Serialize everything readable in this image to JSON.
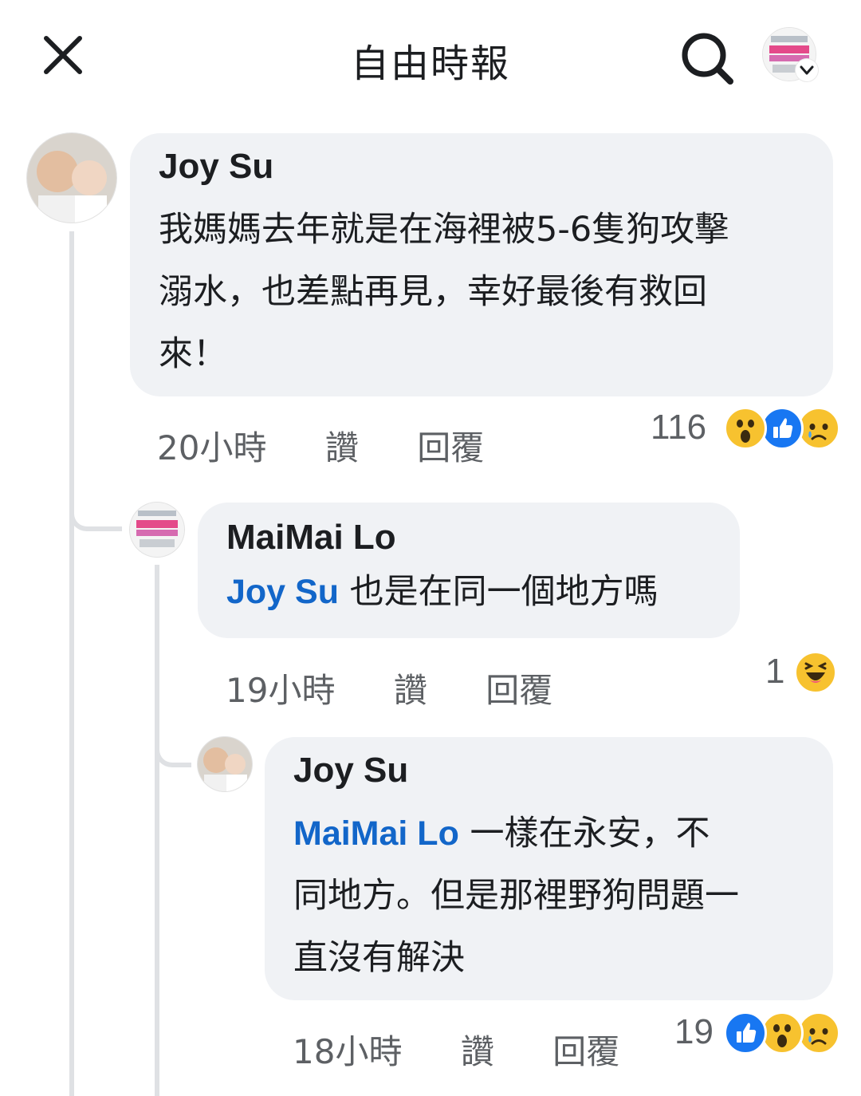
{
  "header": {
    "title": "自由時報",
    "close_icon": "close-icon",
    "search_icon": "search-icon",
    "profile_icon": "profile-avatar",
    "dropdown_icon": "chevron-down-icon"
  },
  "comments": [
    {
      "author": "Joy Su",
      "mention": "",
      "text": "我媽媽去年就是在海裡被5-6隻狗攻擊溺水，也差點再見，幸好最後有救回來！",
      "lines": [
        "我媽媽去年就是在海裡被5-6隻狗攻擊",
        "溺水，也差點再見，幸好最後有救回",
        "來！"
      ],
      "time": "20小時",
      "like_label": "讚",
      "reply_label": "回覆",
      "reaction_count": "116",
      "reactions": [
        "wow-reaction-icon",
        "like-reaction-icon",
        "sad-reaction-icon"
      ]
    },
    {
      "author": "MaiMai Lo",
      "mention": "Joy Su",
      "text": "也是在同一個地方嗎",
      "time": "19小時",
      "like_label": "讚",
      "reply_label": "回覆",
      "reaction_count": "1",
      "reactions": [
        "haha-reaction-icon"
      ]
    },
    {
      "author": "Joy Su",
      "mention": "MaiMai Lo",
      "text": "一樣在永安，不同地方。但是那裡野狗問題一直沒有解決",
      "lines": [
        "一樣在永安，不",
        "同地方。但是那裡野狗問題一",
        "直沒有解決"
      ],
      "time": "18小時",
      "like_label": "讚",
      "reply_label": "回覆",
      "reaction_count": "19",
      "reactions": [
        "like-reaction-icon",
        "wow-reaction-icon",
        "sad-reaction-icon"
      ]
    }
  ],
  "colors": {
    "bubble_bg": "#f0f2f5",
    "mention": "#1266c9",
    "meta_text": "#5d6064",
    "thread_line": "#dfe1e4",
    "like_blue": "#1877f2",
    "reaction_yellow": "#f7c22f"
  }
}
